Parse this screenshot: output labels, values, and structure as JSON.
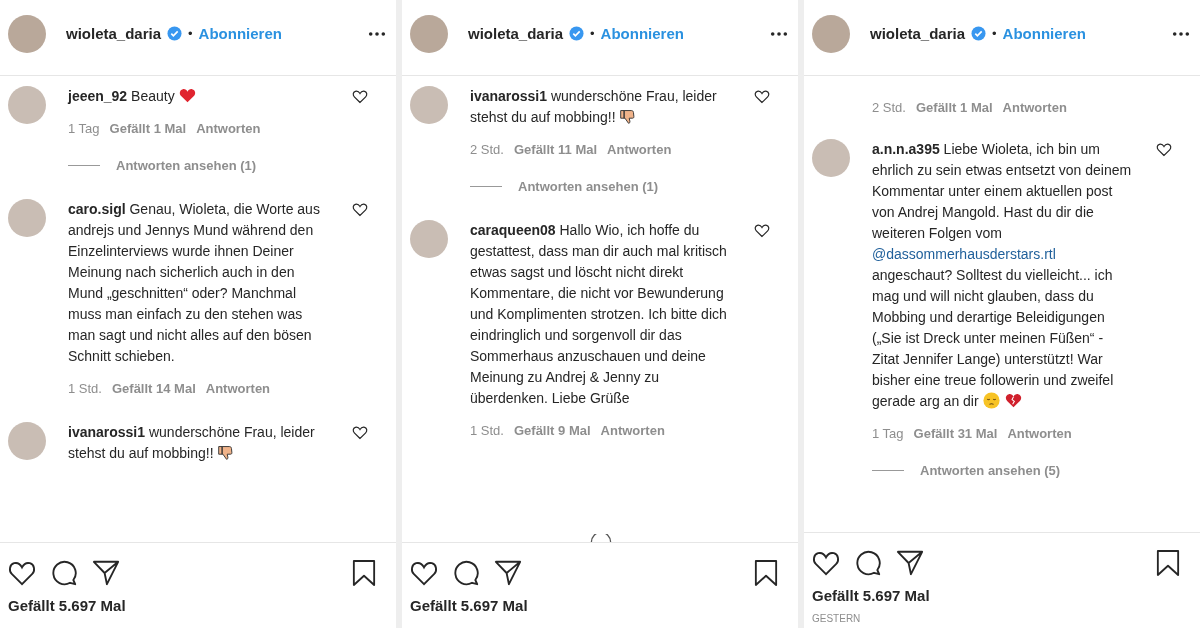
{
  "panels": [
    {
      "header": {
        "username": "wioleta_daria",
        "verified": true,
        "separator": "•",
        "follow": "Abonnieren"
      },
      "comments": [
        {
          "kind": "comment",
          "username": "jeeen_92",
          "parts": [
            {
              "kind": "text",
              "text": "Beauty"
            },
            {
              "kind": "heart"
            }
          ],
          "time": "1 Tag",
          "likes": "Gefällt 1 Mal",
          "reply": "Antworten",
          "view_replies": "Antworten ansehen (1)"
        },
        {
          "kind": "comment",
          "username": "caro.sigl",
          "parts": [
            {
              "kind": "text",
              "text": "Genau, Wioleta, die Worte aus andrejs und Jennys Mund während den Einzelinterviews wurde ihnen Deiner Meinung nach sicherlich auch in den Mund „geschnitten“ oder? Manchmal muss man einfach zu den stehen was man sagt und nicht alles auf den bösen Schnitt schieben."
            }
          ],
          "time": "1 Std.",
          "likes": "Gefällt 14 Mal",
          "reply": "Antworten"
        },
        {
          "kind": "comment",
          "username": "ivanarossi1",
          "parts": [
            {
              "kind": "text",
              "text": "wunderschöne Frau, leider stehst du auf mobbing!!"
            },
            {
              "kind": "thumbs-down"
            }
          ]
        }
      ],
      "loading": false,
      "likes": "Gefällt 5.697 Mal"
    },
    {
      "header": {
        "username": "wioleta_daria",
        "verified": true,
        "separator": "•",
        "follow": "Abonnieren"
      },
      "comments": [
        {
          "kind": "comment",
          "username": "ivanarossi1",
          "parts": [
            {
              "kind": "text",
              "text": "wunderschöne Frau, leider stehst du auf mobbing!!"
            },
            {
              "kind": "thumbs-down"
            }
          ],
          "time": "2 Std.",
          "likes": "Gefällt 11 Mal",
          "reply": "Antworten",
          "view_replies": "Antworten ansehen (1)"
        },
        {
          "kind": "comment",
          "username": "caraqueen08",
          "parts": [
            {
              "kind": "text",
              "text": "Hallo Wio, ich hoffe du gestattest, dass man dir auch mal kritisch etwas sagst und löscht nicht direkt Kommentare, die nicht vor Bewunderung und Komplimenten strotzen. Ich bitte dich eindringlich und sorgenvoll dir das Sommerhaus anzuschauen und deine Meinung zu Andrej & Jenny zu überdenken. Liebe Grüße"
            }
          ],
          "time": "1 Std.",
          "likes": "Gefällt 9 Mal",
          "reply": "Antworten"
        }
      ],
      "loading": true,
      "likes": "Gefällt 5.697 Mal"
    },
    {
      "header": {
        "username": "wioleta_daria",
        "verified": true,
        "separator": "•",
        "follow": "Abonnieren"
      },
      "comments": [
        {
          "kind": "fragment",
          "time": "2 Std.",
          "likes": "Gefällt 1 Mal",
          "reply": "Antworten"
        },
        {
          "kind": "comment",
          "username": "a.n.n.a395",
          "parts": [
            {
              "kind": "text",
              "text": "Liebe Wioleta, ich bin um ehrlich zu sein etwas entsetzt von deinem Kommentar unter einem aktuellen post von Andrej Mangold. Hast du dir die weiteren Folgen vom"
            },
            {
              "kind": "mention",
              "text": "@dassommerhausderstars.rtl"
            },
            {
              "kind": "text",
              "text": "angeschaut? Solltest du vielleicht... ich mag und will nicht glauben, dass du Mobbing und derartige Beleidigungen („Sie ist Dreck unter meinen Füßen“ - Zitat Jennifer Lange) unterstützt! War bisher eine treue followerin und zweifel gerade arg an dir"
            },
            {
              "kind": "pensive"
            },
            {
              "kind": "broken-heart"
            }
          ],
          "time": "1 Tag",
          "likes": "Gefällt 31 Mal",
          "reply": "Antworten",
          "view_replies": "Antworten ansehen (5)"
        }
      ],
      "loading": false,
      "likes": "Gefällt 5.697 Mal",
      "date": "GESTERN"
    }
  ]
}
